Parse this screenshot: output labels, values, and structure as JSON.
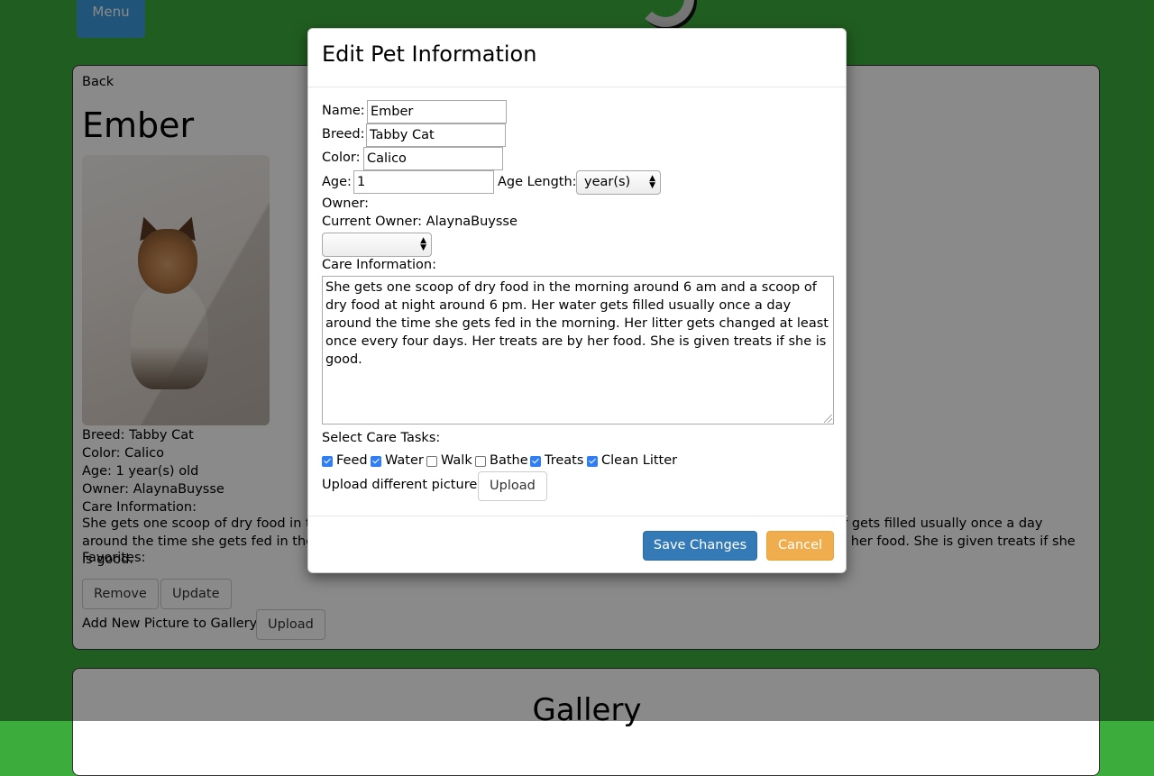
{
  "header": {
    "menu_label": "Menu"
  },
  "pet": {
    "back_label": "Back",
    "name": "Ember",
    "photo_alt": "cat-photo",
    "breed_line": "Breed: Tabby Cat",
    "color_line": "Color: Calico",
    "age_line": "Age: 1 year(s) old",
    "owner_line": "Owner: AlaynaBuysse",
    "care_heading": "Care Information:",
    "care_text": "She gets one scoop of dry food in the morning around 6 am and a scoop of dry food at night around 6 pm. Her water gets filled usually once a day around the time she gets fed in the morning. Her litter gets changed at least once every four days. Her treats are by her food. She is given treats if she is good.",
    "care_visible_left": "She gets one scoop of dry food in th",
    "care_visible_right": "s filled usually once a day around the",
    "care_line2_left": "time she gets fed in the morning. He",
    "care_line2_right": "iven treats if she is good.",
    "favorites_label": "Favorites:",
    "remove_label": "Remove",
    "update_label": "Update",
    "gallery_upload_prompt": "Add New Picture to Gallery:",
    "upload_label": "Upload"
  },
  "gallery": {
    "title": "Gallery"
  },
  "modal": {
    "title": "Edit Pet Information",
    "name_label": "Name:",
    "name_value": "Ember",
    "breed_label": "Breed:",
    "breed_value": "Tabby Cat",
    "color_label": "Color:",
    "color_value": "Calico",
    "age_label": "Age:",
    "age_value": "1",
    "age_length_label": "Age Length:",
    "age_length_value": "year(s)",
    "owner_label": "Owner:",
    "current_owner_text": "Current Owner: AlaynaBuysse",
    "owner_select_value": "",
    "care_label": "Care Information:",
    "care_value": "She gets one scoop of dry food in the morning around 6 am and a scoop of dry food at night around 6 pm. Her water gets filled usually once a day around the time she gets fed in the morning. Her litter gets changed at least once every four days. Her treats are by her food. She is given treats if she is good.",
    "tasks_label": "Select Care Tasks:",
    "tasks": [
      {
        "label": "Feed",
        "checked": true
      },
      {
        "label": "Water",
        "checked": true
      },
      {
        "label": "Walk",
        "checked": false
      },
      {
        "label": "Bathe",
        "checked": false
      },
      {
        "label": "Treats",
        "checked": true
      },
      {
        "label": "Clean Litter",
        "checked": true
      }
    ],
    "upload_prompt": "Upload different picture:",
    "upload_label": "Upload",
    "save_label": "Save Changes",
    "cancel_label": "Cancel"
  },
  "colors": {
    "page_bg": "#3cad3c",
    "menu_button": "#3e9be0",
    "primary": "#337ab7",
    "warning": "#f0ad4e",
    "checkbox": "#2f7ef5"
  }
}
